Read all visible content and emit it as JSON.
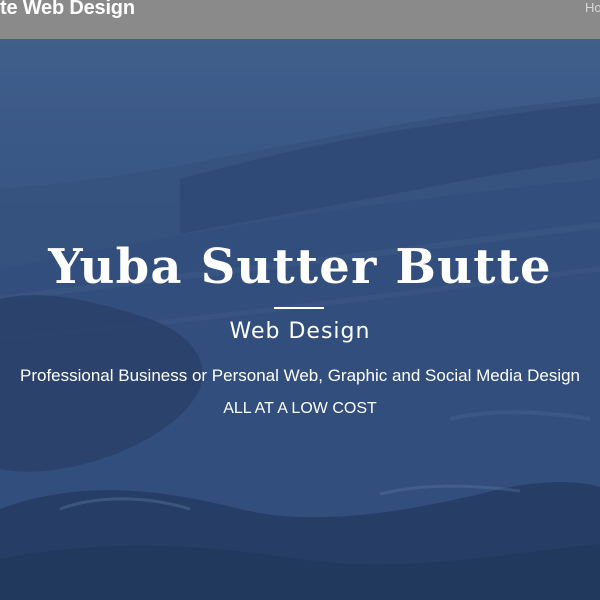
{
  "header": {
    "brand_text": "te Web Design",
    "nav_link": "Ho",
    "bar_color": "#8a8a8a"
  },
  "hero": {
    "title": "Yuba Sutter Butte",
    "subtitle": "Web Design",
    "tagline": "Professional Business or Personal Web, Graphic and Social Media Design",
    "cta": "ALL AT A LOW COST",
    "background_image": "misty-hillside-landscape",
    "overlay_color": "#2d4a75"
  }
}
